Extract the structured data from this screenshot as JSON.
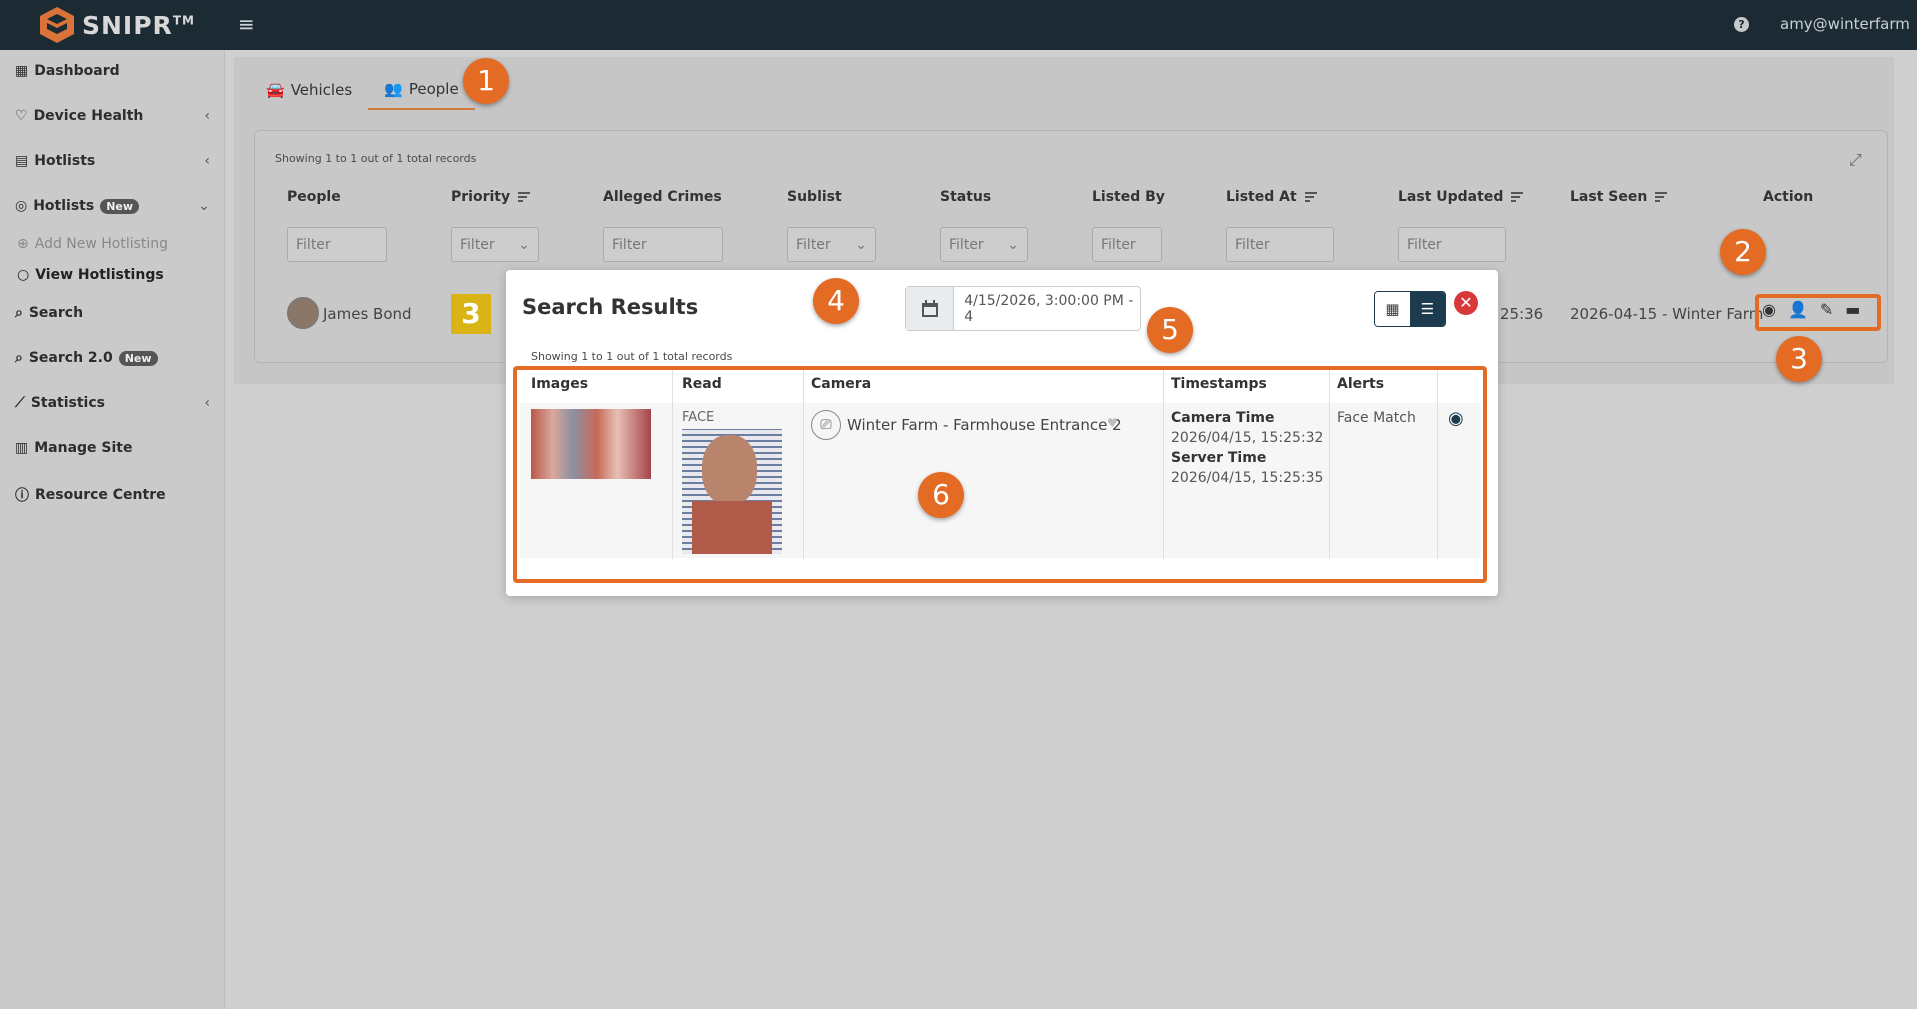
{
  "header": {
    "brand": "SNIPR",
    "brand_tm": "TM",
    "user": "amy@winterfarm",
    "help": "?"
  },
  "sidebar": {
    "items": [
      {
        "label": "Dashboard"
      },
      {
        "label": "Device Health"
      },
      {
        "label": "Hotlists"
      },
      {
        "label": "Hotlists",
        "badge": "New"
      },
      {
        "label": "Add New Hotlisting"
      },
      {
        "label": "View Hotlistings"
      },
      {
        "label": "Search"
      },
      {
        "label": "Search 2.0",
        "badge": "New"
      },
      {
        "label": "Statistics"
      },
      {
        "label": "Manage Site"
      },
      {
        "label": "Resource Centre"
      }
    ]
  },
  "tabs": [
    {
      "label": "Vehicles"
    },
    {
      "label": "People"
    }
  ],
  "table": {
    "records_info": "Showing 1 to 1 out of 1 total records",
    "columns": [
      "People",
      "Priority",
      "Alleged Crimes",
      "Sublist",
      "Status",
      "Listed By",
      "Listed At",
      "Last Updated",
      "Last Seen",
      "Action"
    ],
    "filter_placeholder": "Filter",
    "row": {
      "person": "James Bond",
      "priority": "3",
      "last_updated_partial": "25:36",
      "last_seen": "2026-04-15 - Winter Farm"
    }
  },
  "modal": {
    "title": "Search Results",
    "date_range": "4/15/2026, 3:00:00 PM - 4",
    "records_info": "Showing 1 to 1 out of 1 total records",
    "columns": [
      "Images",
      "Read",
      "Camera",
      "Timestamps",
      "Alerts"
    ],
    "row": {
      "read": "FACE",
      "camera": "Winter Farm - Farmhouse Entrance 2",
      "camera_time_label": "Camera Time",
      "camera_time": "2026/04/15, 15:25:32",
      "server_time_label": "Server Time",
      "server_time": "2026/04/15, 15:25:35",
      "alert": "Face Match"
    }
  },
  "callouts": [
    "1",
    "2",
    "3",
    "4",
    "5",
    "6"
  ],
  "colors": {
    "accent": "#e36b24",
    "topbar": "#1c2b33",
    "close": "#d9383b",
    "priority": "#d8b416"
  }
}
